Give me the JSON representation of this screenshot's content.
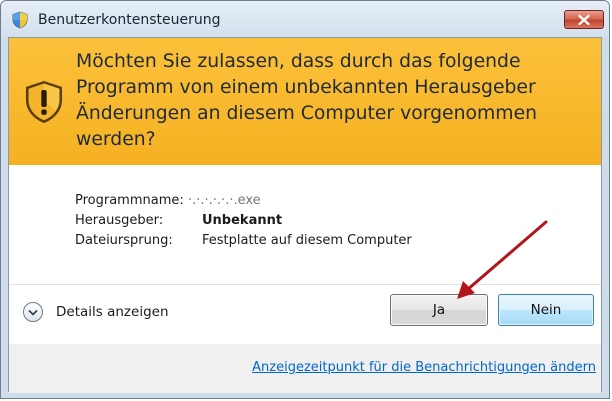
{
  "window": {
    "title": "Benutzerkontensteuerung",
    "close_icon": "close-x"
  },
  "banner": {
    "icon": "uac-shield-warning-icon",
    "message": "Möchten Sie zulassen, dass durch das folgende Programm von einem unbekannten Herausgeber Änderungen an diesem Computer vorgenommen werden?"
  },
  "info": {
    "rows": [
      {
        "label": "Programmname:",
        "value": "·.·.·.·.·.·.exe",
        "style": "redacted"
      },
      {
        "label": "Herausgeber:",
        "value": "Unbekannt",
        "style": "bold"
      },
      {
        "label": "Dateiursprung:",
        "value": "Festplatte auf diesem Computer",
        "style": "normal"
      }
    ]
  },
  "details": {
    "label": "Details anzeigen",
    "icon": "chevron-down-circle-icon"
  },
  "buttons": {
    "yes_label": "Ja",
    "no_label": "Nein"
  },
  "footer": {
    "link_text": "Anzeigezeitpunkt für die Benachrichtigungen ändern"
  },
  "colors": {
    "banner_top": "#fbc13a",
    "banner_bottom": "#f6b122",
    "link": "#0066cc",
    "annotation_arrow": "#b3151b"
  }
}
